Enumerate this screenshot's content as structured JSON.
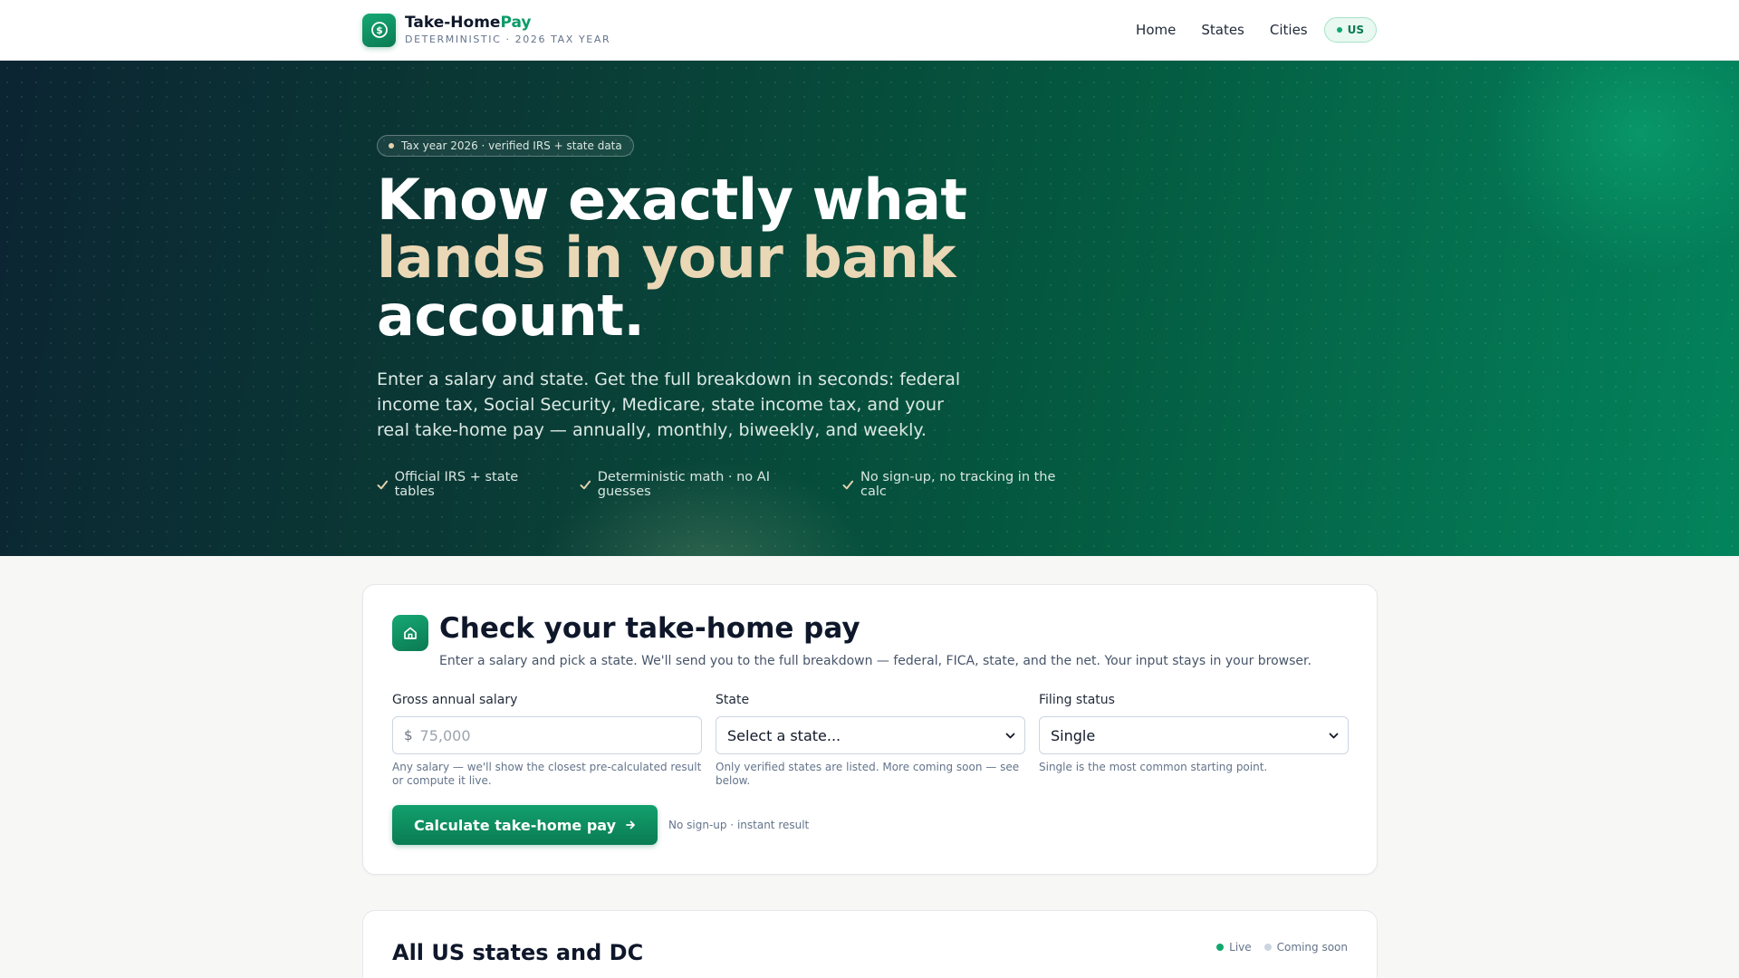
{
  "brand": {
    "name_main": "Take-Home",
    "name_accent": "Pay",
    "subtitle": "DETERMINISTIC · 2026 TAX YEAR",
    "icon": "dollar-icon"
  },
  "nav": {
    "links": [
      "Home",
      "States",
      "Cities"
    ],
    "country": "US"
  },
  "hero": {
    "badge": "Tax year 2026 · verified IRS + state data",
    "title_line1": "Know exactly what",
    "title_line2": "lands in your bank",
    "title_line3": "account.",
    "description": "Enter a salary and state. Get the full breakdown in seconds: federal income tax, Social Security, Medicare, state income tax, and your real take-home pay — annually, monthly, biweekly, and weekly.",
    "checks": [
      "Official IRS + state tables",
      "Deterministic math · no AI guesses",
      "No sign-up, no tracking in the calc"
    ]
  },
  "calculator": {
    "icon": "home-icon",
    "title": "Check your take-home pay",
    "subtitle": "Enter a salary and pick a state. We'll send you to the full breakdown — federal, FICA, state, and the net. Your input stays in your browser.",
    "salary": {
      "label": "Gross annual salary",
      "prefix": "$",
      "placeholder": "75,000",
      "hint": "Any salary — we'll show the closest pre-calculated result or compute it live."
    },
    "state": {
      "label": "State",
      "value": "Select a state...",
      "hint": "Only verified states are listed. More coming soon — see below."
    },
    "filing": {
      "label": "Filing status",
      "value": "Single",
      "hint": "Single is the most common starting point."
    },
    "button_label": "Calculate take-home pay",
    "button_note": "No sign-up · instant result"
  },
  "states_section": {
    "title": "All US states and DC",
    "legend_live": "Live",
    "legend_soon": "Coming soon",
    "live_color": "#10a86f",
    "soon_color": "#cbd5e1"
  },
  "colors": {
    "accent": "#0b9b68",
    "gold": "#ead7b5"
  }
}
